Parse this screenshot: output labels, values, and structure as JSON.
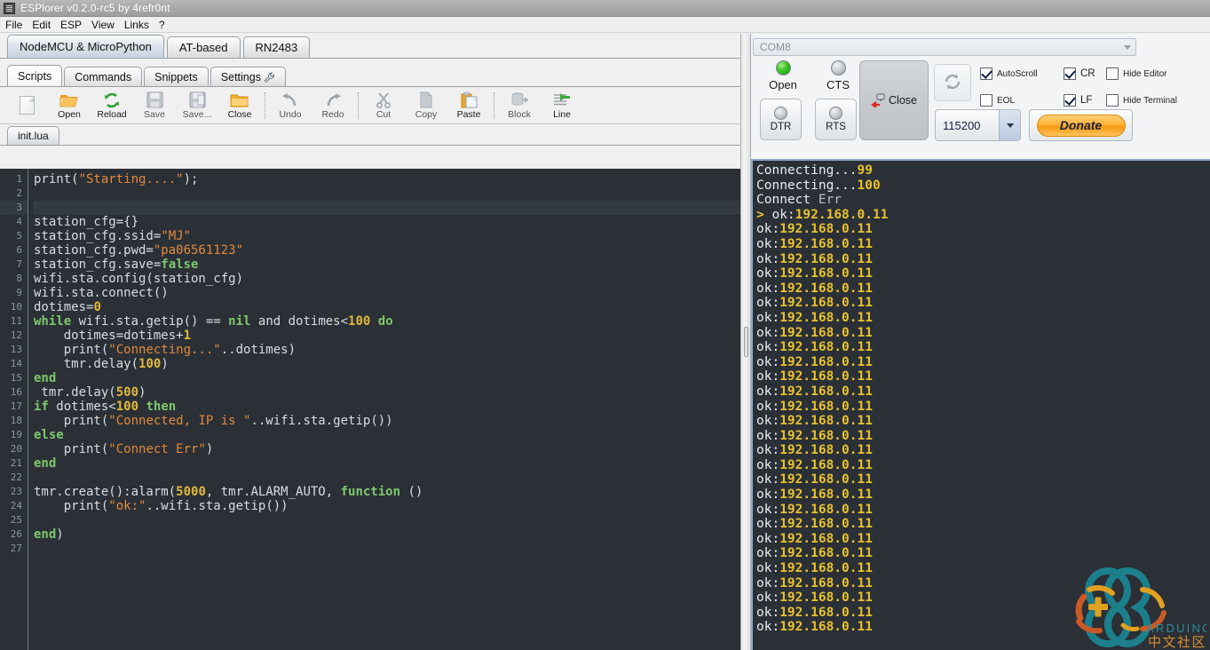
{
  "window": {
    "title": "ESPlorer v0.2.0-rc5 by 4refr0nt",
    "icon": "app-icon"
  },
  "menu": {
    "items": [
      {
        "label": "File"
      },
      {
        "label": "Edit"
      },
      {
        "label": "ESP"
      },
      {
        "label": "View"
      },
      {
        "label": "Links"
      },
      {
        "label": "?"
      }
    ]
  },
  "protocol_tabs": [
    {
      "label": "NodeMCU & MicroPython",
      "active": true
    },
    {
      "label": "AT-based",
      "active": false
    },
    {
      "label": "RN2483",
      "active": false
    }
  ],
  "function_tabs": [
    {
      "label": "Scripts",
      "active": true,
      "icon": ""
    },
    {
      "label": "Commands",
      "active": false,
      "icon": ""
    },
    {
      "label": "Snippets",
      "active": false,
      "icon": ""
    },
    {
      "label": "Settings",
      "active": false,
      "icon": "wrench-icon"
    }
  ],
  "toolbar": {
    "buttons": [
      {
        "label": "",
        "icon": "new-file-icon",
        "enabled": true
      },
      {
        "label": "Open",
        "icon": "open-folder-icon",
        "enabled": true
      },
      {
        "label": "Reload",
        "icon": "reload-icon",
        "enabled": true
      },
      {
        "label": "Save",
        "icon": "save-disk-icon",
        "enabled": false
      },
      {
        "label": "Save...",
        "icon": "save-as-icon",
        "enabled": false
      },
      {
        "label": "Close",
        "icon": "close-folder-icon",
        "enabled": true
      },
      {
        "label": "Undo",
        "icon": "undo-arrow-icon",
        "enabled": false
      },
      {
        "label": "Redo",
        "icon": "redo-arrow-icon",
        "enabled": false
      },
      {
        "label": "Cut",
        "icon": "scissors-icon",
        "enabled": false
      },
      {
        "label": "Copy",
        "icon": "copy-icon",
        "enabled": false
      },
      {
        "label": "Paste",
        "icon": "paste-icon",
        "enabled": true
      },
      {
        "label": "Block",
        "icon": "block-icon",
        "enabled": false
      },
      {
        "label": "Line",
        "icon": "line-icon",
        "enabled": true
      }
    ]
  },
  "file_tabs": [
    {
      "label": "init.lua",
      "active": true
    }
  ],
  "editor": {
    "total_lines": 27,
    "current_line": 3,
    "colors": {
      "background": "#2b3036",
      "current_line": "#343a41",
      "text": "#d6dde3",
      "keyword": "#7ec76b",
      "string": "#e08a3c",
      "number": "#e0b93c",
      "gutter_text": "#8a959e"
    },
    "lines": [
      [
        [
          "p",
          "print("
        ],
        [
          "s",
          "\"Starting....\""
        ],
        [
          "p",
          ");"
        ]
      ],
      [],
      [],
      [
        [
          "p",
          "station_cfg={}"
        ]
      ],
      [
        [
          "p",
          "station_cfg.ssid="
        ],
        [
          "s",
          "\"MJ\""
        ]
      ],
      [
        [
          "p",
          "station_cfg.pwd="
        ],
        [
          "s",
          "\"pa06561123\""
        ]
      ],
      [
        [
          "p",
          "station_cfg.save="
        ],
        [
          "k",
          "false"
        ]
      ],
      [
        [
          "p",
          "wifi.sta.config(station_cfg)"
        ]
      ],
      [
        [
          "p",
          "wifi.sta.connect()"
        ]
      ],
      [
        [
          "p",
          "dotimes="
        ],
        [
          "n",
          "0"
        ]
      ],
      [
        [
          "k",
          "while"
        ],
        [
          "p",
          " wifi.sta.getip() == "
        ],
        [
          "k",
          "nil"
        ],
        [
          "p",
          " and dotimes<"
        ],
        [
          "n",
          "100"
        ],
        [
          "p",
          " "
        ],
        [
          "k",
          "do"
        ]
      ],
      [
        [
          "p",
          "    dotimes=dotimes+"
        ],
        [
          "n",
          "1"
        ]
      ],
      [
        [
          "p",
          "    print("
        ],
        [
          "s",
          "\"Connecting...\""
        ],
        [
          "p",
          "..dotimes)"
        ]
      ],
      [
        [
          "p",
          "    tmr.delay("
        ],
        [
          "n",
          "100"
        ],
        [
          "p",
          ")"
        ]
      ],
      [
        [
          "k",
          "end"
        ]
      ],
      [
        [
          "p",
          " tmr.delay("
        ],
        [
          "n",
          "500"
        ],
        [
          "p",
          ")"
        ]
      ],
      [
        [
          "k",
          "if"
        ],
        [
          "p",
          " dotimes<"
        ],
        [
          "n",
          "100"
        ],
        [
          "p",
          " "
        ],
        [
          "k",
          "then"
        ]
      ],
      [
        [
          "p",
          "    print("
        ],
        [
          "s",
          "\"Connected, IP is \""
        ],
        [
          "p",
          "..wifi.sta.getip())"
        ]
      ],
      [
        [
          "k",
          "else"
        ]
      ],
      [
        [
          "p",
          "    print("
        ],
        [
          "s",
          "\"Connect Err\""
        ],
        [
          "p",
          ")"
        ]
      ],
      [
        [
          "k",
          "end"
        ]
      ],
      [],
      [
        [
          "p",
          "tmr.create():alarm("
        ],
        [
          "n",
          "5000"
        ],
        [
          "p",
          ", tmr.ALARM_AUTO, "
        ],
        [
          "k",
          "function"
        ],
        [
          "p",
          " ()"
        ]
      ],
      [
        [
          "p",
          "    print("
        ],
        [
          "s",
          "\"ok:\""
        ],
        [
          "p",
          "..wifi.sta.getip())"
        ]
      ],
      [],
      [
        [
          "k",
          "end"
        ],
        [
          "p",
          ")"
        ]
      ],
      []
    ]
  },
  "serial": {
    "port": {
      "value": "COM8",
      "icon": "chevron-down-icon"
    },
    "status_leds": [
      {
        "label": "Open",
        "state": "on"
      },
      {
        "label": "CTS",
        "state": "off"
      }
    ],
    "pin_buttons": [
      {
        "label": "DTR",
        "state": "off"
      },
      {
        "label": "RTS",
        "state": "off"
      }
    ],
    "close_button": {
      "label": "Close",
      "icon": "disconnect-plug-icon"
    },
    "refresh_button": {
      "icon": "refresh-icon"
    },
    "checkboxes": [
      {
        "label": "AutoScroll",
        "checked": true
      },
      {
        "label": "EOL",
        "checked": false
      },
      {
        "label": "CR",
        "checked": true
      },
      {
        "label": "LF",
        "checked": true
      },
      {
        "label": "Hide Editor",
        "checked": false
      },
      {
        "label": "Hide Terminal",
        "checked": false
      }
    ],
    "baud": {
      "value": "115200",
      "icon": "chevron-down-icon"
    },
    "donate_button": {
      "label": "Donate",
      "color": "#f59a12"
    }
  },
  "terminal": {
    "colors": {
      "background": "#2b3036",
      "text": "#e9eef2",
      "number": "#e8c22e",
      "dim": "#b7c0c7"
    },
    "lines": [
      [
        [
          "tw",
          "Connecting..."
        ],
        [
          "ty",
          "99"
        ]
      ],
      [
        [
          "tw",
          "Connecting..."
        ],
        [
          "ty",
          "100"
        ]
      ],
      [
        [
          "tw",
          "Connect "
        ],
        [
          "tg",
          "Err"
        ]
      ],
      [
        [
          "ty",
          "> "
        ],
        [
          "tw",
          "ok:"
        ],
        [
          "ty",
          "192.168.0.11"
        ]
      ],
      [
        [
          "tw",
          "ok:"
        ],
        [
          "ty",
          "192.168.0.11"
        ]
      ],
      [
        [
          "tw",
          "ok:"
        ],
        [
          "ty",
          "192.168.0.11"
        ]
      ],
      [
        [
          "tw",
          "ok:"
        ],
        [
          "ty",
          "192.168.0.11"
        ]
      ],
      [
        [
          "tw",
          "ok:"
        ],
        [
          "ty",
          "192.168.0.11"
        ]
      ],
      [
        [
          "tw",
          "ok:"
        ],
        [
          "ty",
          "192.168.0.11"
        ]
      ],
      [
        [
          "tw",
          "ok:"
        ],
        [
          "ty",
          "192.168.0.11"
        ]
      ],
      [
        [
          "tw",
          "ok:"
        ],
        [
          "ty",
          "192.168.0.11"
        ]
      ],
      [
        [
          "tw",
          "ok:"
        ],
        [
          "ty",
          "192.168.0.11"
        ]
      ],
      [
        [
          "tw",
          "ok:"
        ],
        [
          "ty",
          "192.168.0.11"
        ]
      ],
      [
        [
          "tw",
          "ok:"
        ],
        [
          "ty",
          "192.168.0.11"
        ]
      ],
      [
        [
          "tw",
          "ok:"
        ],
        [
          "ty",
          "192.168.0.11"
        ]
      ],
      [
        [
          "tw",
          "ok:"
        ],
        [
          "ty",
          "192.168.0.11"
        ]
      ],
      [
        [
          "tw",
          "ok:"
        ],
        [
          "ty",
          "192.168.0.11"
        ]
      ],
      [
        [
          "tw",
          "ok:"
        ],
        [
          "ty",
          "192.168.0.11"
        ]
      ],
      [
        [
          "tw",
          "ok:"
        ],
        [
          "ty",
          "192.168.0.11"
        ]
      ],
      [
        [
          "tw",
          "ok:"
        ],
        [
          "ty",
          "192.168.0.11"
        ]
      ],
      [
        [
          "tw",
          "ok:"
        ],
        [
          "ty",
          "192.168.0.11"
        ]
      ],
      [
        [
          "tw",
          "ok:"
        ],
        [
          "ty",
          "192.168.0.11"
        ]
      ],
      [
        [
          "tw",
          "ok:"
        ],
        [
          "ty",
          "192.168.0.11"
        ]
      ],
      [
        [
          "tw",
          "ok:"
        ],
        [
          "ty",
          "192.168.0.11"
        ]
      ],
      [
        [
          "tw",
          "ok:"
        ],
        [
          "ty",
          "192.168.0.11"
        ]
      ],
      [
        [
          "tw",
          "ok:"
        ],
        [
          "ty",
          "192.168.0.11"
        ]
      ],
      [
        [
          "tw",
          "ok:"
        ],
        [
          "ty",
          "192.168.0.11"
        ]
      ],
      [
        [
          "tw",
          "ok:"
        ],
        [
          "ty",
          "192.168.0.11"
        ]
      ],
      [
        [
          "tw",
          "ok:"
        ],
        [
          "ty",
          "192.168.0.11"
        ]
      ],
      [
        [
          "tw",
          "ok:"
        ],
        [
          "ty",
          "192.168.0.11"
        ]
      ],
      [
        [
          "tw",
          "ok:"
        ],
        [
          "ty",
          "192.168.0.11"
        ]
      ],
      [
        [
          "tw",
          "ok:"
        ],
        [
          "ty",
          "192.168.0.11"
        ]
      ]
    ],
    "watermark": {
      "text": "ARDUINO",
      "subtext": "中文社区"
    }
  }
}
